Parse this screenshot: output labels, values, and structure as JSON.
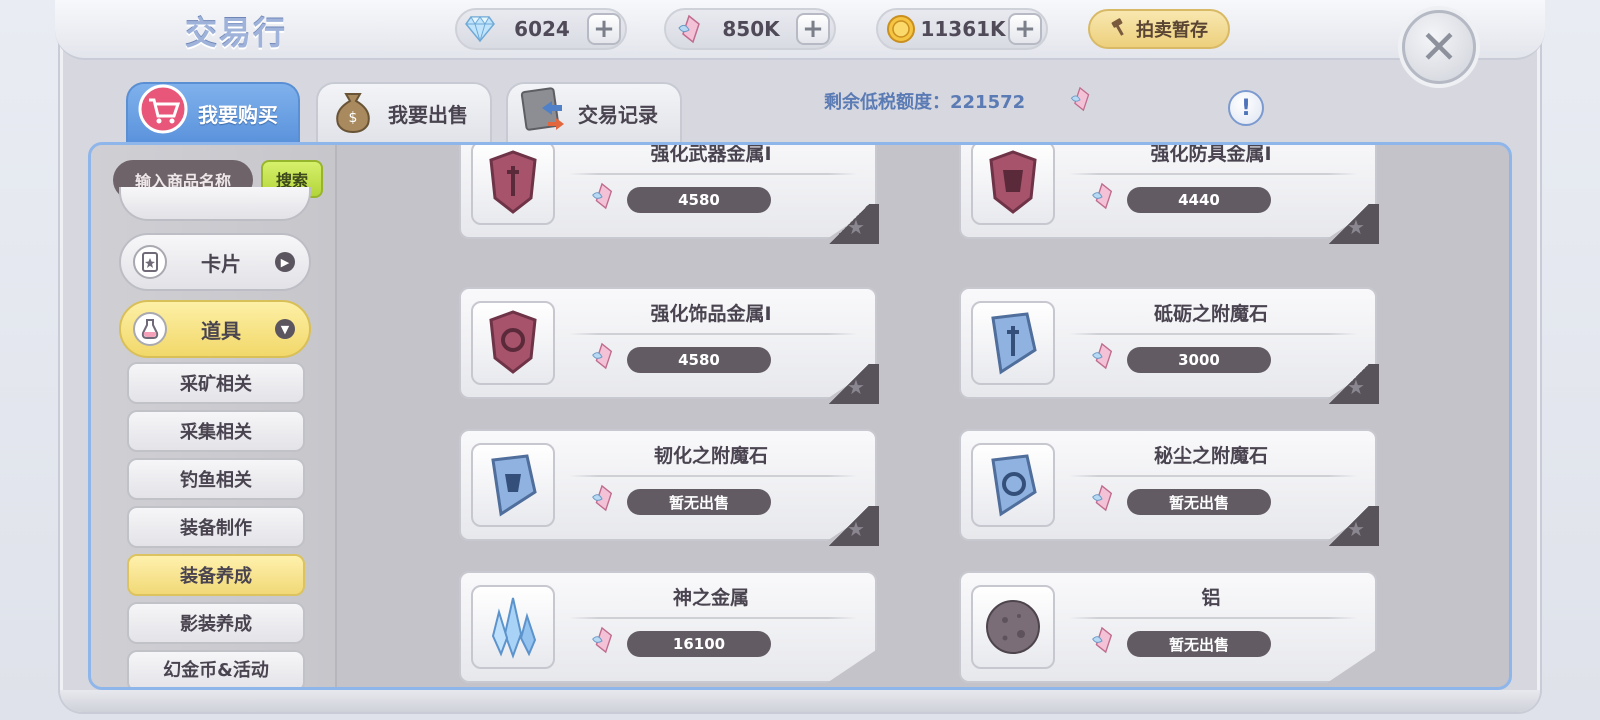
{
  "header": {
    "title": "交易行",
    "currencies": [
      {
        "icon": "diamond-icon",
        "value": "6024"
      },
      {
        "icon": "feather-crystal-icon",
        "value": "850K"
      },
      {
        "icon": "gold-coin-icon",
        "value": "11361K"
      }
    ],
    "plus_label": "+",
    "auction_label": "拍卖暂存",
    "close_label": "✕"
  },
  "tabs": [
    {
      "label": "我要购买",
      "icon": "shopping-cart-icon",
      "active": true
    },
    {
      "label": "我要出售",
      "icon": "money-bag-icon",
      "active": false
    },
    {
      "label": "交易记录",
      "icon": "ledger-icon",
      "active": false
    }
  ],
  "tax": {
    "label": "剩余低税额度：221572"
  },
  "info_label": "!",
  "sidebar": {
    "search_placeholder": "输入商品名称",
    "search_button": "搜索",
    "categories": [
      {
        "label": "卡片",
        "icon": "card-icon",
        "expanded": false
      },
      {
        "label": "道具",
        "icon": "potion-icon",
        "expanded": true
      }
    ],
    "subcategories": [
      "采矿相关",
      "采集相关",
      "钓鱼相关",
      "装备制作",
      "装备养成",
      "影装养成",
      "幻金币&活动"
    ],
    "active_subcategory": "装备养成"
  },
  "items": [
    {
      "name": "强化武器金属Ⅰ",
      "price": "4580",
      "icon": "red-sword-shield-icon"
    },
    {
      "name": "强化防具金属Ⅰ",
      "price": "4440",
      "icon": "red-armor-shield-icon"
    },
    {
      "name": "强化饰品金属Ⅰ",
      "price": "4580",
      "icon": "red-ring-shield-icon"
    },
    {
      "name": "砥砺之附魔石",
      "price": "3000",
      "icon": "blue-sword-stone-icon"
    },
    {
      "name": "韧化之附魔石",
      "price": "暂无出售",
      "icon": "blue-armor-stone-icon"
    },
    {
      "name": "秘尘之附魔石",
      "price": "暂无出售",
      "icon": "blue-ring-stone-icon"
    },
    {
      "name": "神之金属",
      "price": "16100",
      "icon": "crystal-cluster-icon"
    },
    {
      "name": "铝",
      "price": "暂无出售",
      "icon": "ore-stone-icon"
    }
  ],
  "colors": {
    "tab_active": "#5b93dc",
    "panel_border": "#8fb6ea",
    "price_pill": "#625b64",
    "highlight": "#f2d86a"
  }
}
